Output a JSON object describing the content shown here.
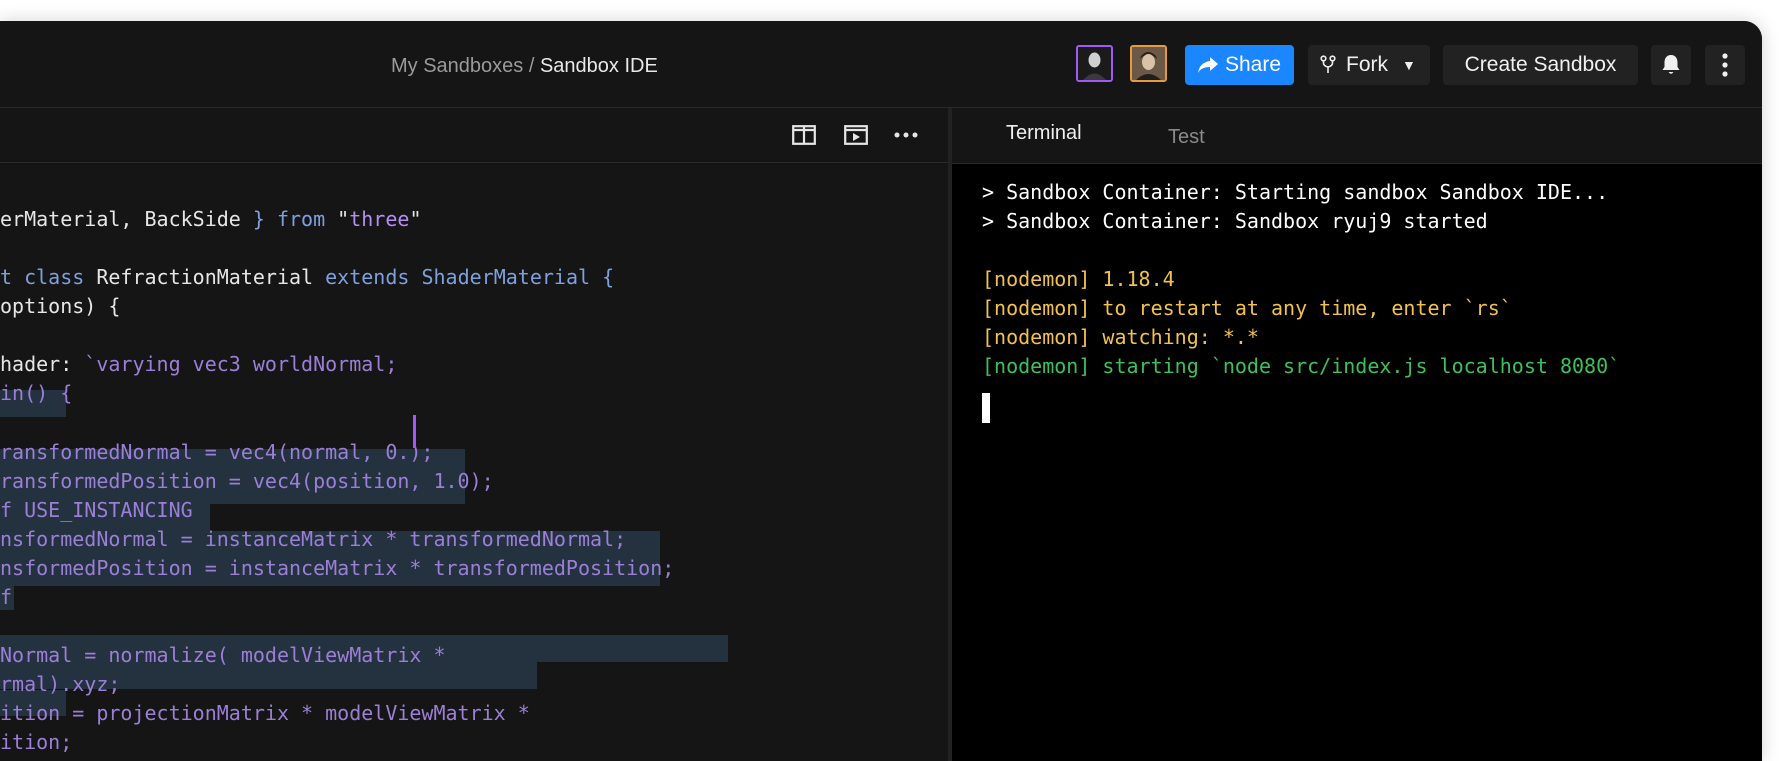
{
  "header": {
    "breadcrumb_parent": "My Sandboxes",
    "breadcrumb_sep": " / ",
    "breadcrumb_current": "Sandbox IDE",
    "share_label": "Share",
    "fork_label": "Fork",
    "create_label": "Create Sandbox",
    "colors": {
      "share": "#1a86ff",
      "avatar1_border": "#a259f5",
      "avatar2_border": "#e69a3a"
    }
  },
  "editor": {
    "tokens": {
      "l0a": "erMaterial, BackSide ",
      "l0b": "} from ",
      "l0c": "\"",
      "l0d": "three",
      "l0e": "\"",
      "l1a": "t ",
      "l1b": "class ",
      "l1c": "RefractionMaterial ",
      "l1d": "extends ShaderMaterial {",
      "l2": "options) {",
      "l3a": "hader: ",
      "l3b": "`varying vec3 worldNormal;",
      "l4": "in() {",
      "l5a": "ransformedNormal = vec4(normal, ",
      "l5b": "0.);",
      "l6": "ransformedPosition = vec4(position, 1.0);",
      "l7": "f USE_INSTANCING",
      "l8": "nsformedNormal = instanceMatrix * transformedNormal;",
      "l9": "nsformedPosition = instanceMatrix * transformedPosition;",
      "l10": "f",
      "l11": "Normal = normalize( modelViewMatrix *",
      "l12": "rmal).xyz;",
      "l13": "ition = projectionMatrix * modelViewMatrix *",
      "l14": "ition;"
    }
  },
  "terminal": {
    "tabs": [
      "Terminal",
      "Test"
    ],
    "lines": [
      {
        "text": "> Sandbox Container: Starting sandbox Sandbox IDE...",
        "color": "#ffffff"
      },
      {
        "text": "> Sandbox Container: Sandbox ryuj9 started",
        "color": "#ffffff"
      },
      {
        "text": "",
        "color": "#ffffff"
      },
      {
        "text": "[nodemon] 1.18.4",
        "color": "#f2c14e"
      },
      {
        "text": "[nodemon] to restart at any time, enter `rs`",
        "color": "#f2c14e"
      },
      {
        "text": "[nodemon] watching: *.*",
        "color": "#f2c14e"
      },
      {
        "text": "[nodemon] starting `node src/index.js localhost 8080`",
        "color": "#3fbf5c"
      }
    ]
  }
}
